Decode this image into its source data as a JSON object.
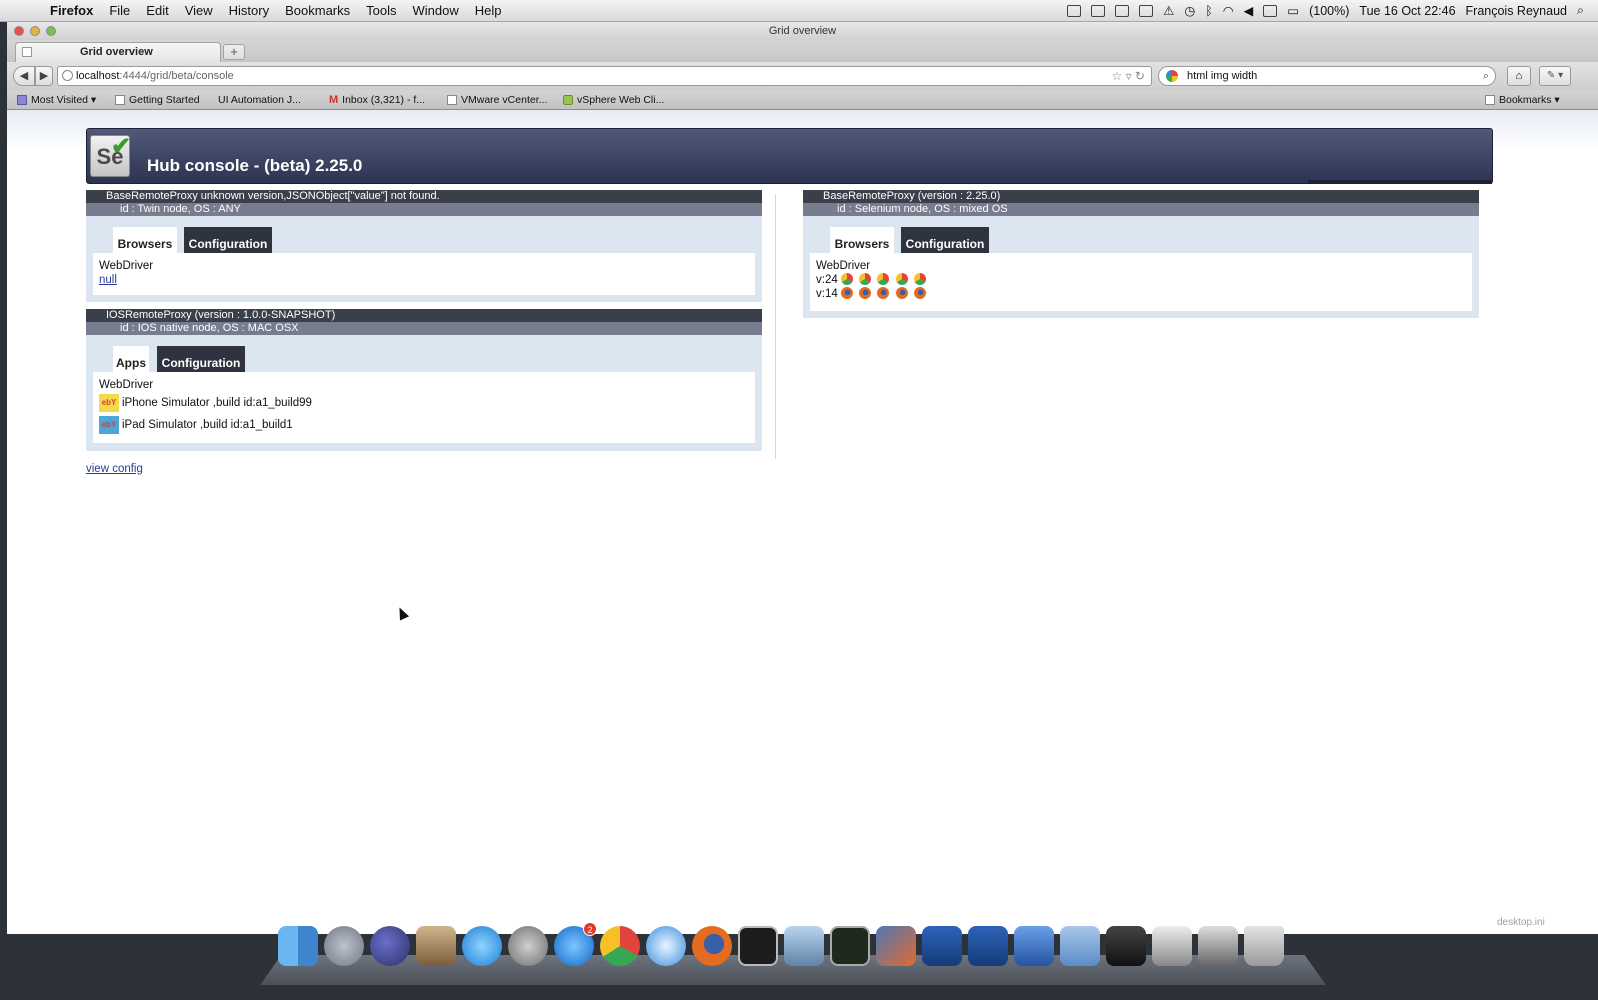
{
  "menubar": {
    "app": "Firefox",
    "items": [
      "File",
      "Edit",
      "View",
      "History",
      "Bookmarks",
      "Tools",
      "Window",
      "Help"
    ],
    "battery": "(100%)",
    "clock": "Tue 16 Oct  22:46",
    "user": "François Reynaud"
  },
  "window": {
    "title": "Grid overview",
    "tab_label": "Grid overview",
    "new_tab": "+",
    "url_host": "localhost",
    "url_path": ":4444/grid/beta/console",
    "search_value": "html img width"
  },
  "bookmarks": [
    {
      "label": "Most Visited ▾",
      "icon": "most-visited-icon"
    },
    {
      "label": "Getting Started",
      "icon": "page-icon"
    },
    {
      "label": "UI Automation J...",
      "icon": "apple-icon"
    },
    {
      "label": "Inbox (3,321) - f...",
      "icon": "gmail-icon"
    },
    {
      "label": "VMware vCenter...",
      "icon": "page-icon"
    },
    {
      "label": "vSphere Web Cli...",
      "icon": "vsphere-icon"
    }
  ],
  "bookmarks_menu": "Bookmarks ▾",
  "hub": {
    "logo_text": "Se",
    "title": "Hub console - (beta) 2.25.0"
  },
  "proxies": [
    {
      "header": "BaseRemoteProxy unknown version,JSONObject[\"value\"] not found.",
      "id": "id : Twin node, OS : ANY",
      "tab_active": "Browsers",
      "tab_inactive": "Configuration",
      "protocol": "WebDriver",
      "link": "null"
    },
    {
      "header": "IOSRemoteProxy (version : 1.0.0-SNAPSHOT)",
      "id": "id : IOS native node, OS : MAC OSX",
      "tab_active": "Apps",
      "tab_inactive": "Configuration",
      "protocol": "WebDriver",
      "apps": [
        {
          "label": "iPhone Simulator ,build id:a1_build99",
          "icon": "ebay-iphone-icon"
        },
        {
          "label": "iPad Simulator ,build id:a1_build1",
          "icon": "ebay-ipad-icon"
        }
      ]
    },
    {
      "header": "BaseRemoteProxy (version : 2.25.0)",
      "id": "id : Selenium node, OS : mixed OS",
      "tab_active": "Browsers",
      "tab_inactive": "Configuration",
      "protocol": "WebDriver",
      "versions": [
        {
          "label": "v:24",
          "browser": "chrome-icon",
          "count": 5
        },
        {
          "label": "v:14",
          "browser": "firefox-icon",
          "count": 5
        }
      ]
    }
  ],
  "view_config": "view config",
  "dock_badge": "2",
  "desktop_label": "desktop.ini"
}
